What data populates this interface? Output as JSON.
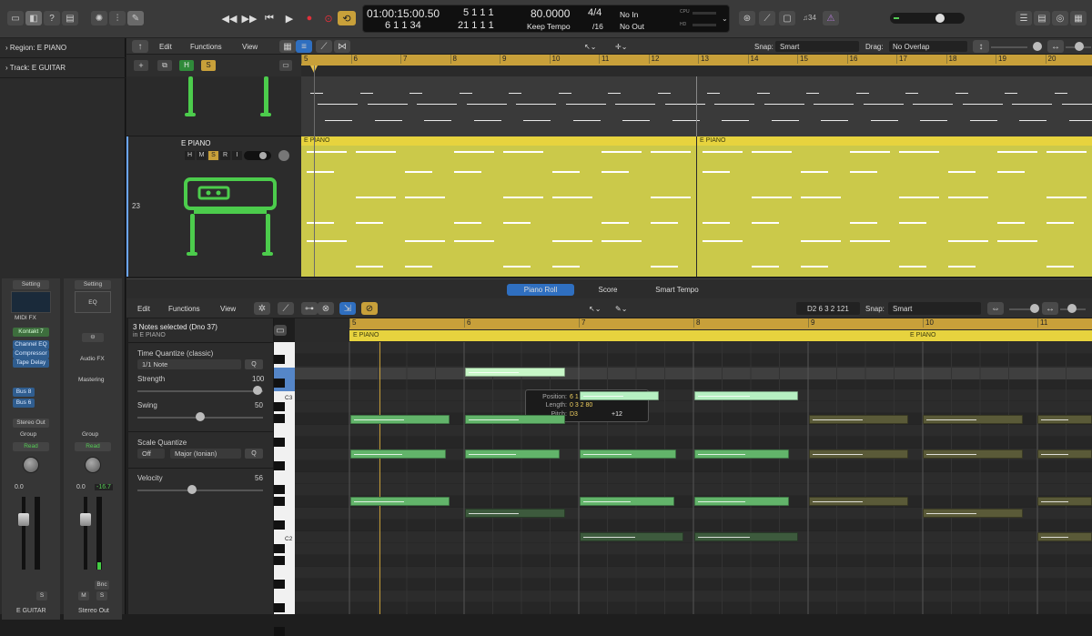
{
  "colors": {
    "region_yellow": "#cbc94a",
    "note_green": "#62b46a",
    "note_light": "#b6f0c2",
    "accent_gold": "#c8a03a",
    "blue_sel": "#2f6fc0"
  },
  "toolbar": {
    "icons": [
      "library-icon",
      "inspector-icon",
      "help-icon",
      "toolbar-icon",
      "smart-controls-icon",
      "editors-icon"
    ],
    "transport": [
      "rewind-icon",
      "fast-forward-icon",
      "go-to-start-icon",
      "play-icon",
      "record-icon",
      "capture-record-icon",
      "cycle-icon"
    ],
    "lcd": {
      "time": "01:00:15:00.50",
      "bars_top": "5  1  1     1",
      "bars_bottom": "6  1  1    34",
      "bars_bottom2": "21  1  1     1",
      "tempo": "80.0000",
      "keep_tempo": "Keep Tempo",
      "sig": "4/4",
      "div": "/16",
      "in": "No In",
      "out": "No Out",
      "cpu": "CPU",
      "hd": "HD"
    },
    "right_counter": "♫34"
  },
  "inspector": {
    "region": "Region:  E PIANO",
    "track": "Track:  E GUITAR",
    "left_strip": {
      "setting": "Setting",
      "midi_fx": "MIDI FX",
      "instrument": "Kontakt 7",
      "fx": [
        "Channel EQ",
        "Compressor",
        "Tape Delay"
      ],
      "sends": [
        "Bus 8",
        "Bus 6"
      ],
      "output": "Stereo Out",
      "group": "Group",
      "auto": "Read",
      "vol": "0.0",
      "btn_s": "S",
      "name": "E GUITAR"
    },
    "right_strip": {
      "setting": "Setting",
      "eq": "EQ",
      "audio_fx": "Audio FX",
      "mastering": "Mastering",
      "group": "Group",
      "auto": "Read",
      "vol": "0.0",
      "peak": "-16.7",
      "bnc": "Bnc",
      "btn_m": "M",
      "btn_s": "S",
      "name": "Stereo Out"
    }
  },
  "arrange": {
    "menus": [
      "Edit",
      "Functions",
      "View"
    ],
    "snap_label": "Snap:",
    "snap": "Smart",
    "drag_label": "Drag:",
    "drag": "No Overlap",
    "ruler": [
      "5",
      "6",
      "7",
      "8",
      "9",
      "10",
      "11",
      "12",
      "13",
      "14",
      "15",
      "16",
      "17",
      "18",
      "19",
      "20"
    ],
    "track_buttons": [
      "+",
      "H",
      "S"
    ],
    "track_name": "E PIANO",
    "track_num": "23",
    "track_btns": [
      "H",
      "M",
      "S",
      "R",
      "I"
    ],
    "regions": [
      "E PIANO",
      "E PIANO"
    ]
  },
  "pianoroll": {
    "tabs": [
      "Piano Roll",
      "Score",
      "Smart Tempo"
    ],
    "menus": [
      "Edit",
      "Functions",
      "View"
    ],
    "position": "D2   6 3 2 121",
    "snap_label": "Snap:",
    "snap": "Smart",
    "ruler": [
      "5",
      "6",
      "7",
      "8",
      "9",
      "10",
      "11"
    ],
    "region_label": "E PIANO",
    "region_label2": "E PIANO",
    "selected": "3 Notes selected (Dno 37)",
    "in_region": "in E PIANO",
    "tq_label": "Time Quantize (classic)",
    "tq_value": "1/1 Note",
    "q": "Q",
    "strength_label": "Strength",
    "strength": "100",
    "swing_label": "Swing",
    "swing": "50",
    "sq_label": "Scale Quantize",
    "sq_off": "Off",
    "sq_scale": "Major (Ionian)",
    "velocity_label": "Velocity",
    "velocity": "56",
    "keys": [
      "C3",
      "C2"
    ],
    "tooltip": {
      "pos_label": "Position:",
      "pos": "6 1 1 1",
      "len_label": "Length:",
      "len": "0 3 2 80",
      "pitch_label": "Pitch:",
      "pitch": "D3",
      "delta": "+12"
    }
  }
}
